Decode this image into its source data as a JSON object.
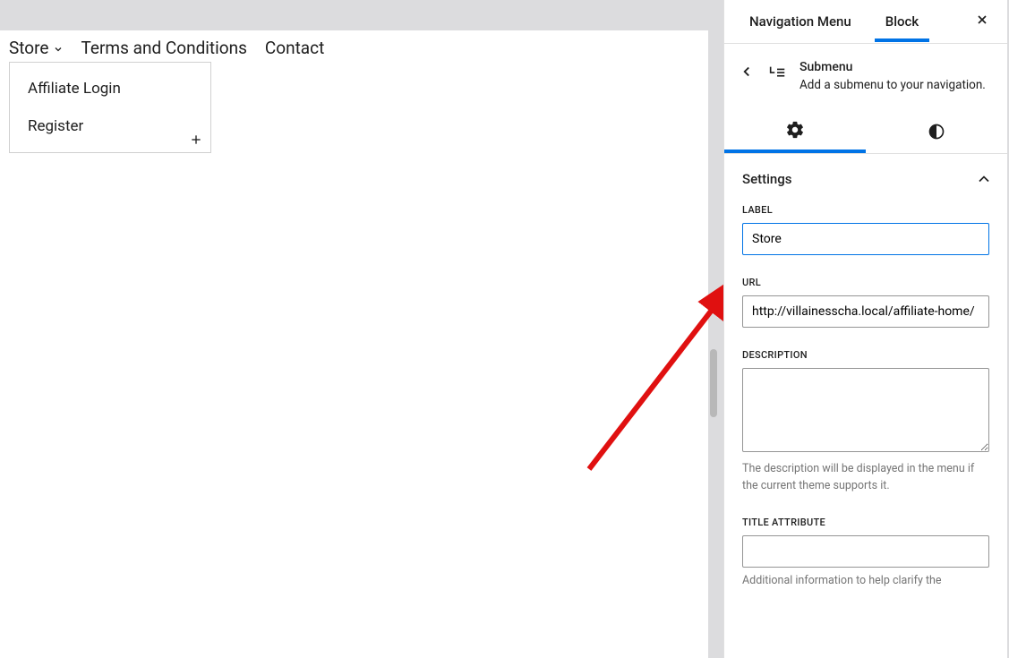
{
  "sidebar": {
    "tabs": {
      "navigation": "Navigation Menu",
      "block": "Block"
    },
    "block": {
      "title": "Submenu",
      "description": "Add a submenu to your navigation."
    },
    "settings": {
      "header": "Settings",
      "label": {
        "label": "Label",
        "value": "Store"
      },
      "url": {
        "label": "URL",
        "value": "http://villainesscha.local/affiliate-home/"
      },
      "description": {
        "label": "Description",
        "value": "",
        "help": "The description will be displayed in the menu if the current theme supports it."
      },
      "titleAttr": {
        "label": "Title Attribute",
        "value": "",
        "help": "Additional information to help clarify the"
      }
    }
  },
  "canvas": {
    "nav": {
      "items": [
        "Store",
        "Terms and Conditions",
        "Contact"
      ]
    },
    "submenu": {
      "items": [
        "Affiliate Login",
        "Register"
      ]
    }
  }
}
